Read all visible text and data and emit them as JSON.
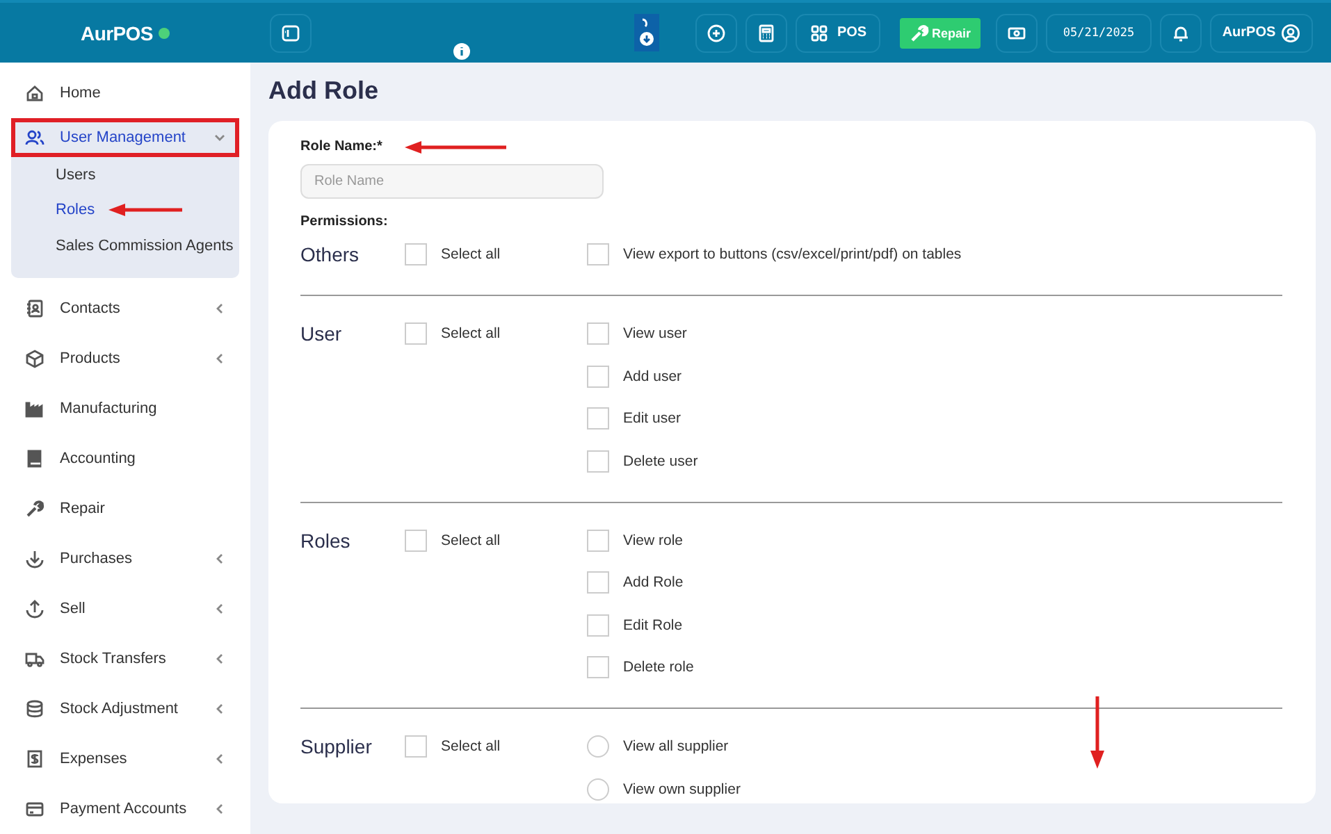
{
  "brand": {
    "name": "AurPOS",
    "online": true
  },
  "topbar": {
    "pos_label": "POS",
    "repair_label": "Repair",
    "date": "05/21/2025",
    "user": "AurPOS"
  },
  "sidebar": {
    "items": [
      {
        "label": "Home",
        "selected": false
      },
      {
        "label": "User Management",
        "selected": true,
        "expanded": true,
        "children": [
          {
            "label": "Users",
            "selected": false
          },
          {
            "label": "Roles",
            "selected": true
          },
          {
            "label": "Sales Commission Agents",
            "selected": false
          }
        ]
      },
      {
        "label": "Contacts",
        "selected": false,
        "expanded": false
      },
      {
        "label": "Products",
        "selected": false,
        "expanded": false
      },
      {
        "label": "Manufacturing",
        "selected": false
      },
      {
        "label": "Accounting",
        "selected": false
      },
      {
        "label": "Repair",
        "selected": false
      },
      {
        "label": "Purchases",
        "selected": false,
        "expanded": false
      },
      {
        "label": "Sell",
        "selected": false,
        "expanded": false
      },
      {
        "label": "Stock Transfers",
        "selected": false,
        "expanded": false
      },
      {
        "label": "Stock Adjustment",
        "selected": false,
        "expanded": false
      },
      {
        "label": "Expenses",
        "selected": false,
        "expanded": false
      },
      {
        "label": "Payment Accounts",
        "selected": false,
        "expanded": false
      }
    ]
  },
  "page": {
    "title": "Add Role",
    "role_name_label": "Role Name:*",
    "role_name_placeholder": "Role Name",
    "permissions_label": "Permissions:"
  },
  "sections": [
    {
      "title": "Others",
      "select_all": {
        "label": "Select all",
        "checked": false
      },
      "items": [
        {
          "kind": "checkbox",
          "label": "View export to buttons (csv/excel/print/pdf) on tables",
          "checked": false
        }
      ]
    },
    {
      "title": "User",
      "select_all": {
        "label": "Select all",
        "checked": false
      },
      "items": [
        {
          "kind": "checkbox",
          "label": "View user",
          "checked": false
        },
        {
          "kind": "checkbox",
          "label": "Add user",
          "checked": false
        },
        {
          "kind": "checkbox",
          "label": "Edit user",
          "checked": false
        },
        {
          "kind": "checkbox",
          "label": "Delete user",
          "checked": false
        }
      ]
    },
    {
      "title": "Roles",
      "select_all": {
        "label": "Select all",
        "checked": false
      },
      "items": [
        {
          "kind": "checkbox",
          "label": "View role",
          "checked": false
        },
        {
          "kind": "checkbox",
          "label": "Add Role",
          "checked": false
        },
        {
          "kind": "checkbox",
          "label": "Edit Role",
          "checked": false
        },
        {
          "kind": "checkbox",
          "label": "Delete role",
          "checked": false
        }
      ]
    },
    {
      "title": "Supplier",
      "select_all": {
        "label": "Select all",
        "checked": false
      },
      "items": [
        {
          "kind": "radio",
          "label": "View all supplier",
          "checked": false
        },
        {
          "kind": "radio",
          "label": "View own supplier",
          "checked": false
        }
      ]
    }
  ]
}
